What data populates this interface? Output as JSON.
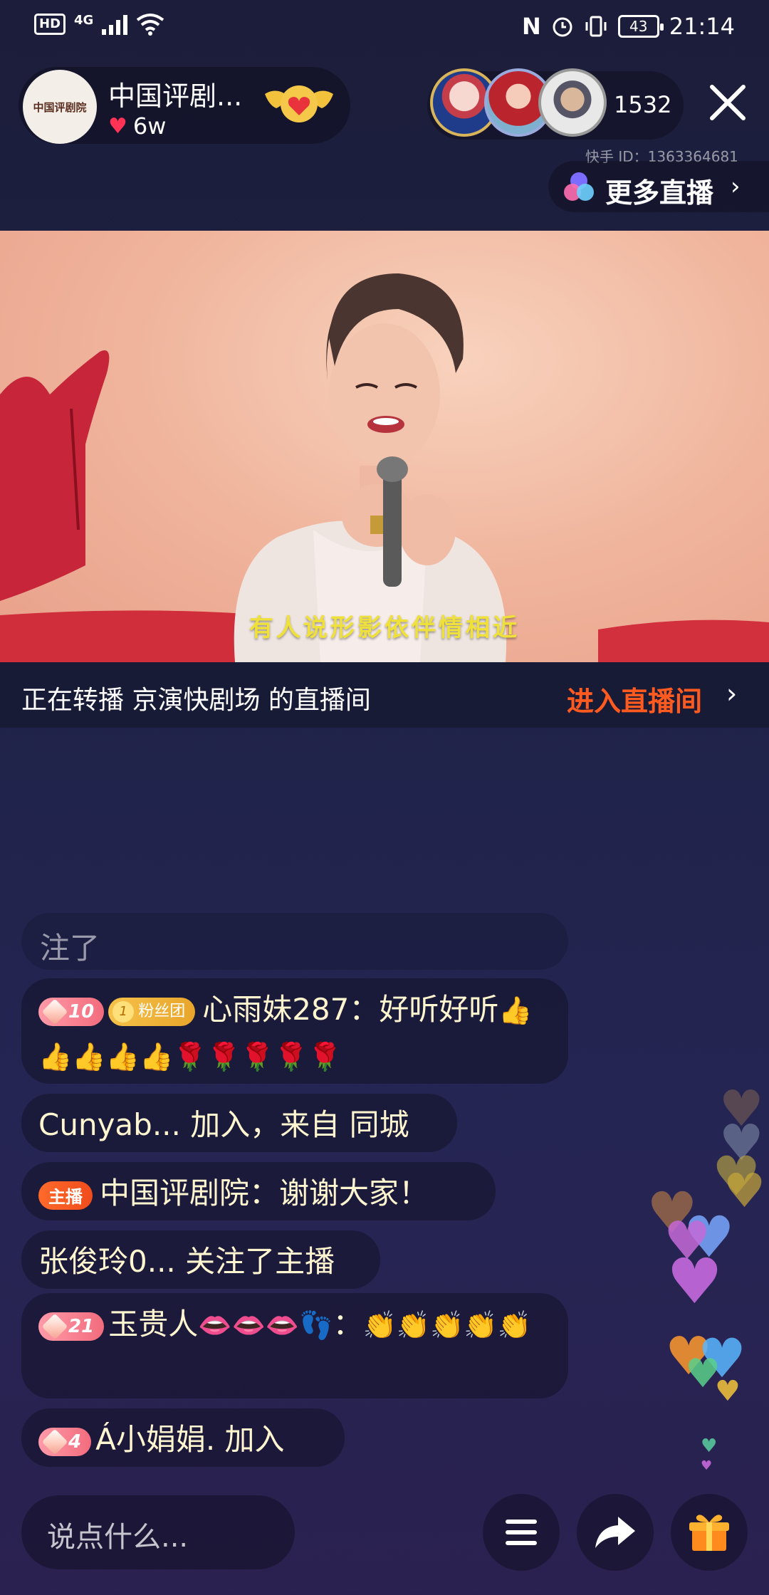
{
  "status_bar": {
    "hd": "HD",
    "network": "4G",
    "nfc": "N",
    "battery": "43",
    "time": "21:14"
  },
  "header": {
    "streamer_name": "中国评剧...",
    "avatar_text": "中国评剧院",
    "likes": "6w",
    "viewer_count": "1532",
    "kuaishou_id": "快手 ID：1363364681",
    "more_live_label": "更多直播"
  },
  "video": {
    "subtitle": "有人说形影依伴情相近"
  },
  "relay": {
    "text": "正在转播 京演快剧场 的直播间",
    "enter_label": "进入直播间"
  },
  "chat": {
    "faded": "注了",
    "msg1": {
      "level": "10",
      "fan_level": "1",
      "fan_label": "粉丝团",
      "user": "心雨妹287：",
      "text": "好听好听",
      "emojis": "👍👍👍👍👍🌹🌹🌹🌹🌹"
    },
    "msg2": "Cunyab... 加入，来自 同城",
    "msg3": {
      "host_tag": "主播",
      "text": "中国评剧院：谢谢大家！"
    },
    "msg4": "张俊玲0... 关注了主播",
    "msg5": {
      "level": "21",
      "user": "玉贵人",
      "user_emojis": "👄👄👄👣",
      "colon": "：",
      "emojis": "👏👏👏👏👏"
    },
    "msg6": {
      "level": "4",
      "text": "Á小娟娟. 加入"
    }
  },
  "bottom": {
    "input_placeholder": "说点什么..."
  },
  "colors": {
    "accent_orange": "#ff5a1f",
    "chat_text": "#fff5cf",
    "subtitle_yellow": "#f0e13a"
  }
}
